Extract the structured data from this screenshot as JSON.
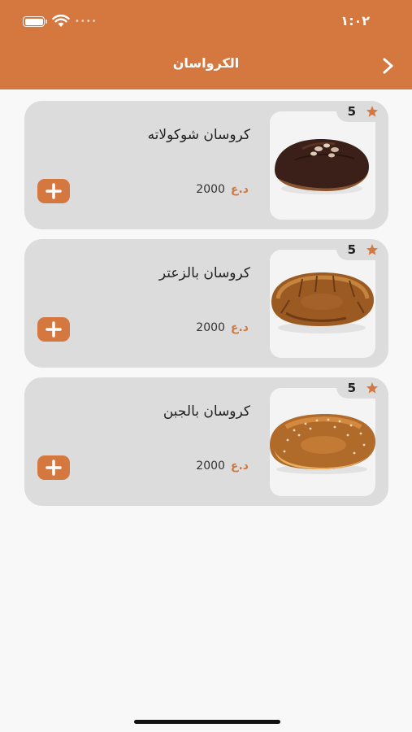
{
  "status_bar": {
    "time": "١:٠٢"
  },
  "header": {
    "title": "الكرواسان"
  },
  "colors": {
    "accent": "#d57840",
    "card": "#dcdcdc",
    "background": "#f8f8f8"
  },
  "products": [
    {
      "name": "كروسان شوكولاته",
      "price": "2000",
      "currency": "د.ع",
      "rating": "5",
      "image": "chocolate-croissant"
    },
    {
      "name": "كروسان بالزعتر",
      "price": "2000",
      "currency": "د.ع",
      "rating": "5",
      "image": "zaatar-croissant"
    },
    {
      "name": "كروسان بالجبن",
      "price": "2000",
      "currency": "د.ع",
      "rating": "5",
      "image": "cheese-croissant"
    }
  ]
}
